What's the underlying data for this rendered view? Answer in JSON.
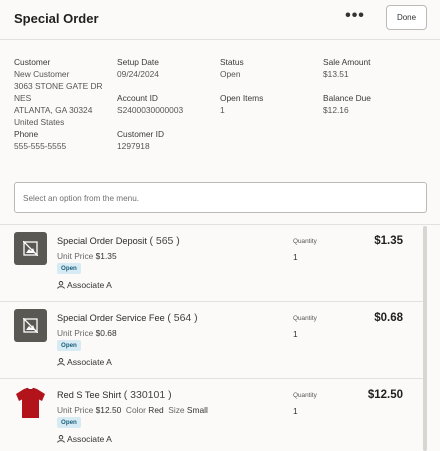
{
  "header": {
    "title": "Special Order",
    "more_label": "•••",
    "done_label": "Done"
  },
  "info": {
    "customer": {
      "label": "Customer",
      "name": "New Customer",
      "address1": "3063 STONE GATE DR",
      "address2": "NES",
      "city": "ATLANTA, GA 30324",
      "country": "United States"
    },
    "phone": {
      "label": "Phone",
      "value": "555-555-5555"
    },
    "setup_date": {
      "label": "Setup Date",
      "value": "09/24/2024"
    },
    "account_id": {
      "label": "Account ID",
      "value": "S2400030000003"
    },
    "customer_id": {
      "label": "Customer ID",
      "value": "1297918"
    },
    "status": {
      "label": "Status",
      "value": "Open"
    },
    "open_items": {
      "label": "Open Items",
      "value": "1"
    },
    "sale_amount": {
      "label": "Sale Amount",
      "value": "$13.51"
    },
    "balance_due": {
      "label": "Balance Due",
      "value": "$12.16"
    }
  },
  "select": {
    "placeholder": "Select an option from the menu."
  },
  "items": [
    {
      "name": "Special Order Deposit",
      "id": "( 565 )",
      "unit_price_label": "Unit Price",
      "unit_price": "$1.35",
      "status": "Open",
      "associate": "Associate A",
      "quantity_label": "Quantity",
      "quantity": "1",
      "total": "$1.35"
    },
    {
      "name": "Special Order Service Fee",
      "id": "( 564 )",
      "unit_price_label": "Unit Price",
      "unit_price": "$0.68",
      "status": "Open",
      "associate": "Associate A",
      "quantity_label": "Quantity",
      "quantity": "1",
      "total": "$0.68"
    },
    {
      "name": "Red S Tee Shirt",
      "id": "( 330101 )",
      "unit_price_label": "Unit Price",
      "unit_price": "$12.50",
      "color_label": "Color",
      "color": "Red",
      "size_label": "Size",
      "size": "Small",
      "status": "Open",
      "associate": "Associate A",
      "quantity_label": "Quantity",
      "quantity": "1",
      "total": "$12.50"
    }
  ],
  "icons": {
    "placeholder_image": "no-image-icon",
    "shirt_image": "red-tee-shirt-image",
    "associate": "person-icon"
  },
  "colors": {
    "badge_bg": "#d6ebf4",
    "badge_text": "#1b5e7a",
    "shirt": "#b3141c"
  }
}
